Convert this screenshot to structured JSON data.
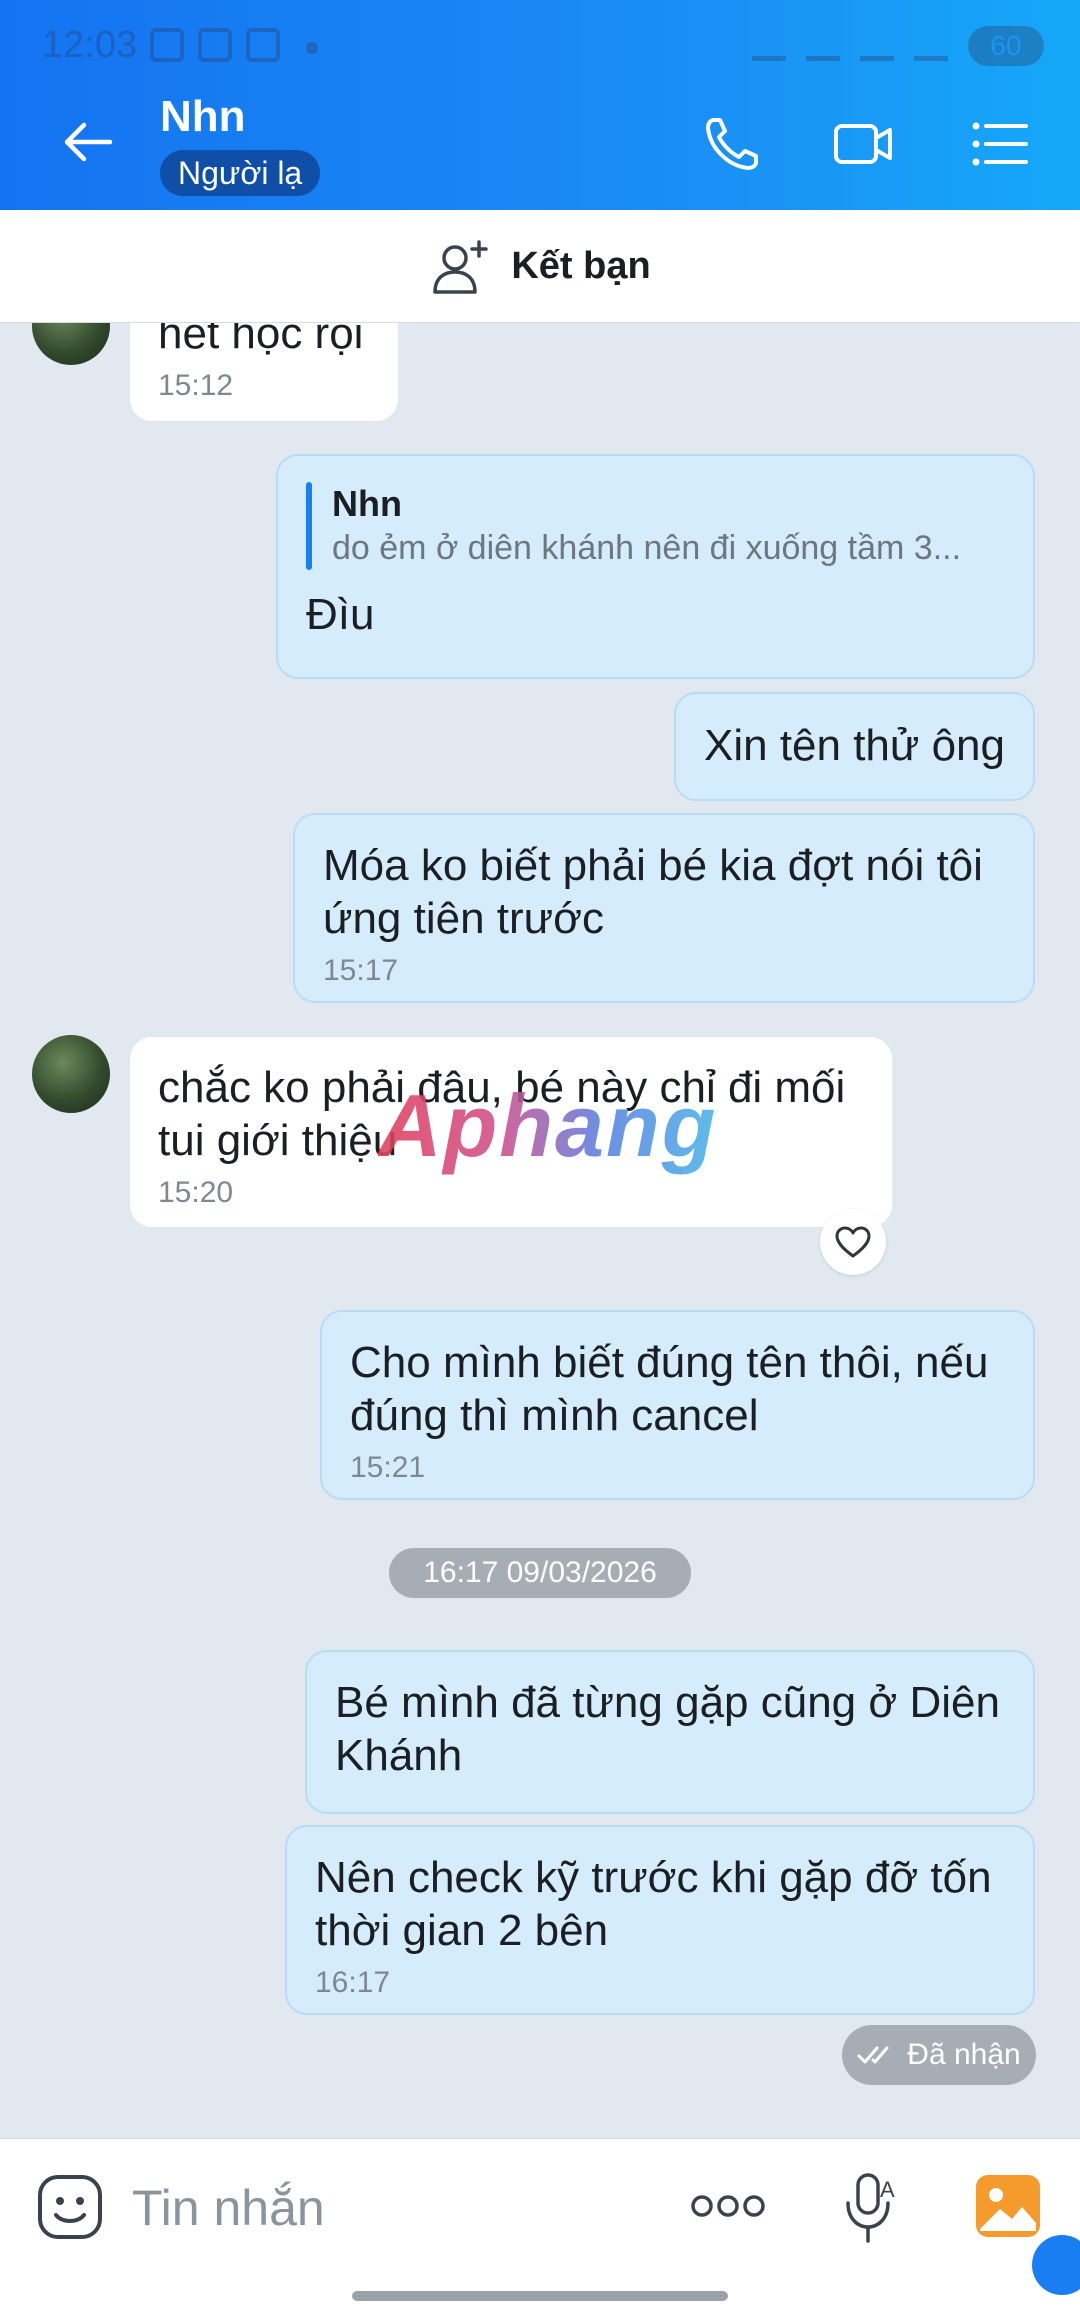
{
  "status": {
    "time": "12:03",
    "battery": "60"
  },
  "header": {
    "contact_name": "Nhn",
    "badge": "Người lạ"
  },
  "add_friend": {
    "label": "Kết bạn"
  },
  "messages": [
    {
      "dir": "in",
      "text": "hết học rội",
      "time": "15:12"
    },
    {
      "dir": "out",
      "quote_name": "Nhn",
      "quote_text": "do ẻm ở diên khánh nên đi xuống tầm 3...",
      "text": "Đìu"
    },
    {
      "dir": "out",
      "text": "Xin tên thử ông"
    },
    {
      "dir": "out",
      "text": "Móa ko biết phải bé kia đợt nói tôi ứng tiên trước",
      "time": "15:17"
    },
    {
      "dir": "in",
      "text": "chắc ko phải đâu, bé này chỉ đi mối tui giới thiệu",
      "time": "15:20"
    },
    {
      "dir": "out",
      "text": "Cho mình biết đúng tên thôi, nếu đúng thì mình cancel",
      "time": "15:21"
    },
    {
      "dir": "out",
      "text": "Bé mình đã từng gặp cũng ở Diên Khánh"
    },
    {
      "dir": "out",
      "text": "Nên check kỹ trước khi gặp đỡ tốn thời gian 2 bên",
      "time": "16:17"
    }
  ],
  "date_separator": "16:17 09/03/2026",
  "receipt": "Đã nhận",
  "watermark": "Aphang",
  "input": {
    "placeholder": "Tin nhắn"
  },
  "colors": {
    "accent": "#1a7ef3",
    "out_bubble": "#d5ecfc",
    "chat_bg": "#e2e8ef"
  }
}
